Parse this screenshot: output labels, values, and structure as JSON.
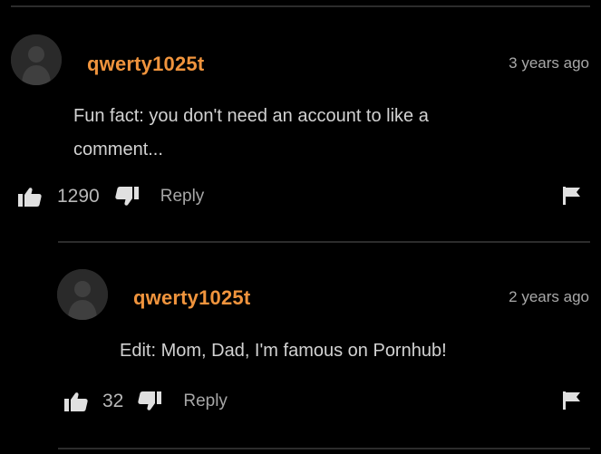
{
  "comments": [
    {
      "username": "qwerty1025t",
      "timestamp": "3 years ago",
      "text": "Fun fact: you don't need an account to like a comment...",
      "likes": "1290",
      "reply_label": "Reply"
    },
    {
      "username": "qwerty1025t",
      "timestamp": "2 years ago",
      "text": "Edit: Mom, Dad, I'm famous on Pornhub!",
      "likes": "32",
      "reply_label": "Reply"
    }
  ],
  "colors": {
    "background": "#000000",
    "username": "#f0943d",
    "text": "#d2d2d2",
    "meta": "#a8a8a8",
    "icon": "#e0e0e0",
    "divider": "#2c2c2c"
  },
  "icons": [
    "avatar-placeholder",
    "thumbs-up-icon",
    "thumbs-down-icon",
    "flag-icon"
  ]
}
